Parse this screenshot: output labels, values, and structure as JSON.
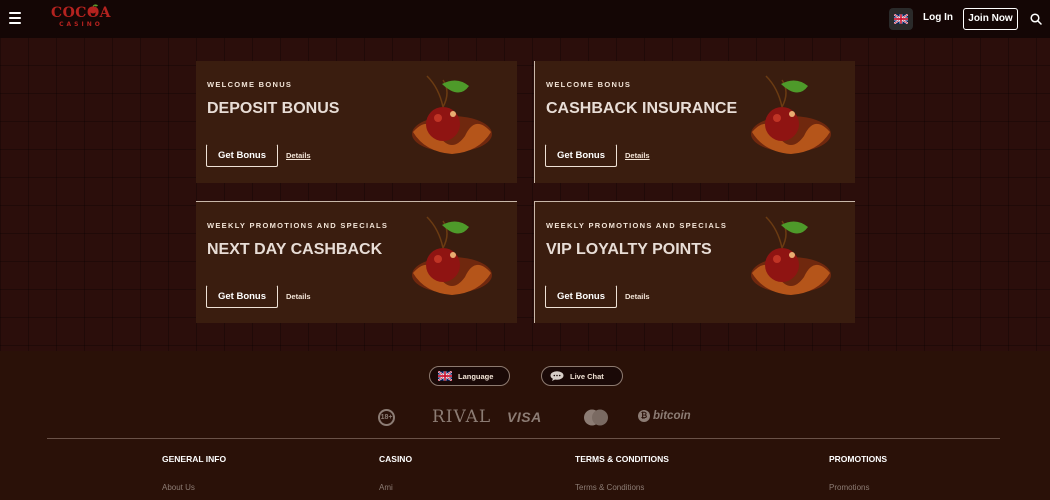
{
  "header": {
    "logo_text": "COCOA",
    "logo_subtext": "CASINO",
    "login_label": "Log In",
    "join_label": "Join Now",
    "icons": [
      "hamburger-menu-icon",
      "uk-flag-icon",
      "search-icon"
    ]
  },
  "cards": [
    {
      "eyebrow": "WELCOME BONUS",
      "title": "DEPOSIT BONUS",
      "button": "Get Bonus",
      "details": "Details"
    },
    {
      "eyebrow": "WELCOME BONUS",
      "title": "CASHBACK INSURANCE",
      "button": "Get Bonus",
      "details": "Details"
    },
    {
      "eyebrow": "WEEKLY PROMOTIONS AND SPECIALS",
      "title": "NEXT DAY CASHBACK",
      "button": "Get Bonus",
      "details": "Details"
    },
    {
      "eyebrow": "WEEKLY PROMOTIONS AND SPECIALS",
      "title": "VIP LOYALTY POINTS",
      "button": "Get Bonus",
      "details": "Details"
    }
  ],
  "footer": {
    "language_label": "Language",
    "live_chat_label": "Live Chat",
    "payments": {
      "age": "18+",
      "rival": "RIVAL",
      "visa": "VISA",
      "mastercard": "MasterCard",
      "bitcoin": "bitcoin"
    },
    "columns": [
      {
        "heading": "GENERAL INFO",
        "first_link": "About Us"
      },
      {
        "heading": "CASINO",
        "first_link": "Ami"
      },
      {
        "heading": "TERMS & CONDITIONS",
        "first_link": "Terms & Conditions"
      },
      {
        "heading": "PROMOTIONS",
        "first_link": "Promotions"
      }
    ]
  },
  "colors": {
    "background": "#2b0e0b",
    "card": "#3a1d0f",
    "brand_red": "#b4221f",
    "header": "#140605"
  }
}
